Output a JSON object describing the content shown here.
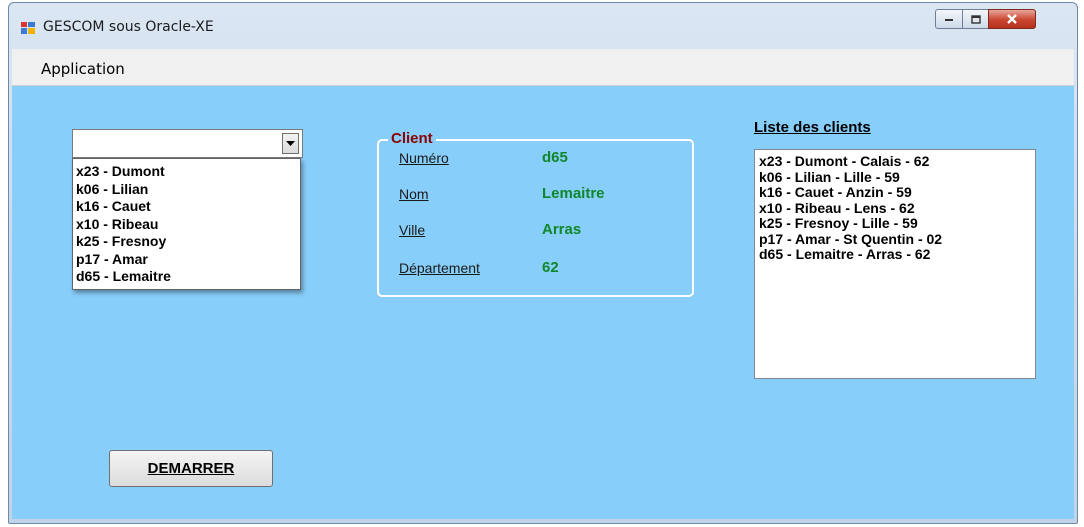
{
  "window": {
    "title": "GESCOM sous Oracle-XE",
    "controls": [
      "minimize-icon",
      "maximize-icon",
      "close-icon"
    ]
  },
  "menu": {
    "items": [
      {
        "label": "Application"
      }
    ]
  },
  "combo": {
    "value": "",
    "items": [
      "x23 - Dumont",
      "k06 - Lilian",
      "k16 - Cauet",
      "x10 - Ribeau",
      "k25 - Fresnoy",
      "p17 - Amar",
      "d65 - Lemaitre"
    ]
  },
  "client": {
    "legend": "Client",
    "fields": [
      {
        "label": "Numéro",
        "value": "d65"
      },
      {
        "label": "Nom",
        "value": "Lemaitre"
      },
      {
        "label": "Ville",
        "value": "Arras"
      },
      {
        "label": "Département",
        "value": "62"
      }
    ]
  },
  "list": {
    "caption": "Liste des clients",
    "items": [
      "x23 - Dumont - Calais - 62",
      "k06 - Lilian - Lille - 59",
      "k16 - Cauet - Anzin - 59",
      "x10 - Ribeau - Lens - 62",
      "k25 - Fresnoy - Lille - 59",
      "p17 - Amar - St Quentin - 02",
      "d65 - Lemaitre - Arras - 62"
    ]
  },
  "actions": {
    "start_label": "DEMARRER"
  },
  "colors": {
    "client_bg": "#87cefa",
    "legend": "#8b0000",
    "value": "#11862a"
  }
}
